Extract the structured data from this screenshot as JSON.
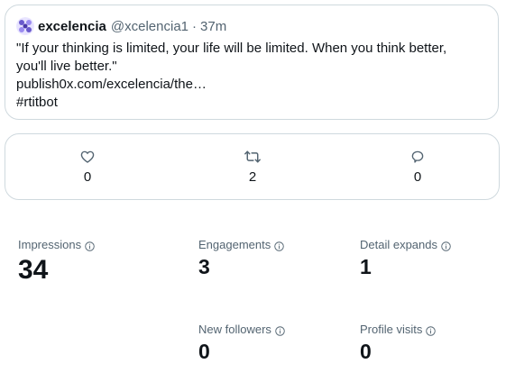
{
  "tweet": {
    "author_name": "excelencia",
    "author_handle": "@xcelencia1",
    "separator": "·",
    "time": "37m",
    "text": "\"If your thinking is limited, your life will be limited. When you think better,\nyou'll live better.\"\npublish0x.com/excelencia/the…\n#rtitbot"
  },
  "engagement_bar": {
    "likes": "0",
    "retweets": "2",
    "replies": "0"
  },
  "stats": {
    "impressions": {
      "label": "Impressions",
      "value": "34"
    },
    "engagements": {
      "label": "Engagements",
      "value": "3"
    },
    "detail_expands": {
      "label": "Detail expands",
      "value": "1"
    },
    "new_followers": {
      "label": "New followers",
      "value": "0"
    },
    "profile_visits": {
      "label": "Profile visits",
      "value": "0"
    }
  },
  "colors": {
    "text": "#0f1419",
    "muted": "#536471",
    "border": "#cfd9de",
    "avatar": "#6a5acd"
  }
}
